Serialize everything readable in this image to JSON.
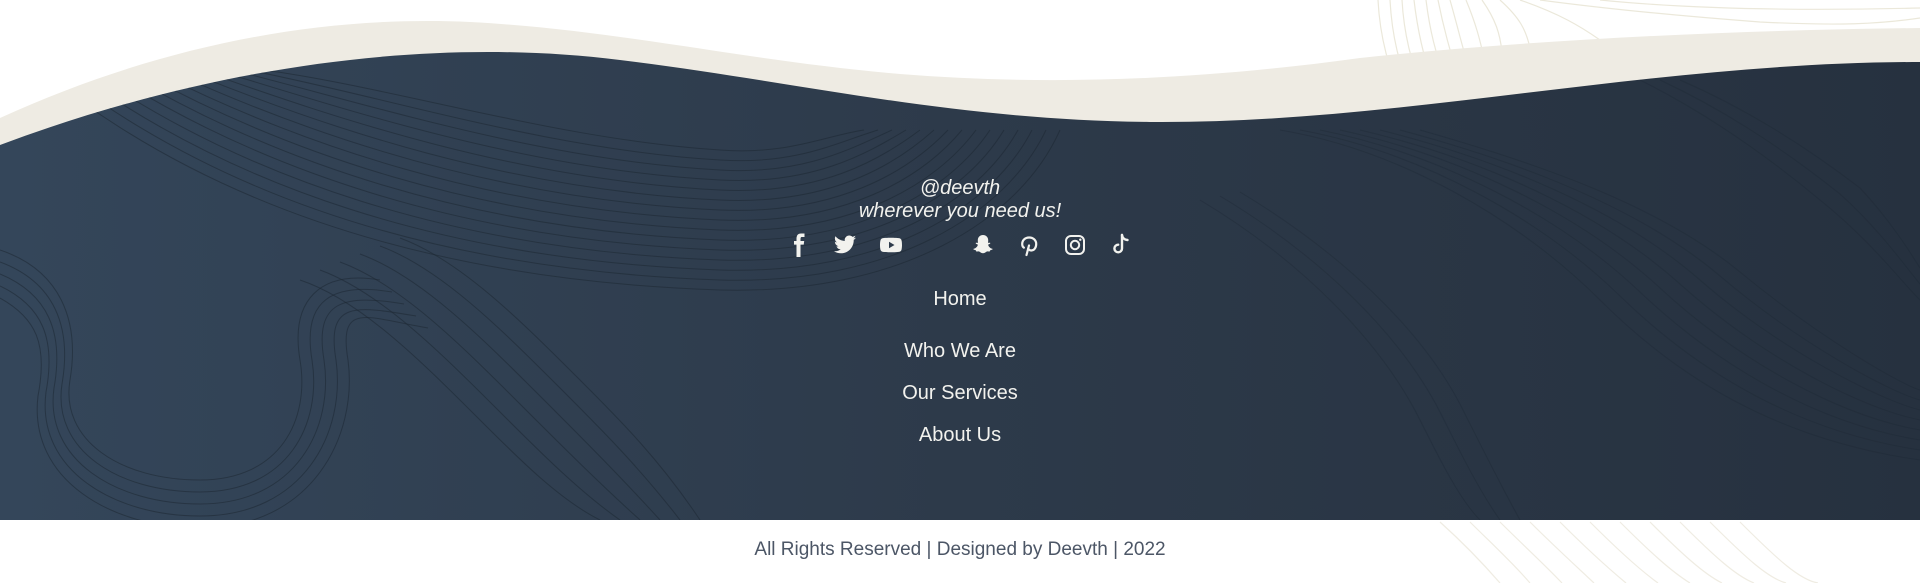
{
  "footer": {
    "handle": "@deevth",
    "tagline": "wherever you need us!",
    "social": [
      {
        "icon": "facebook-icon",
        "label": "Facebook"
      },
      {
        "icon": "twitter-icon",
        "label": "Twitter"
      },
      {
        "icon": "youtube-icon",
        "label": "YouTube"
      },
      {
        "icon": "empty-icon-slot",
        "label": ""
      },
      {
        "icon": "snapchat-icon",
        "label": "Snapchat"
      },
      {
        "icon": "pinterest-icon",
        "label": "Pinterest"
      },
      {
        "icon": "instagram-icon",
        "label": "Instagram"
      },
      {
        "icon": "tiktok-icon",
        "label": "TikTok"
      }
    ],
    "nav": {
      "home": "Home",
      "who_we_are": "Who We Are",
      "our_services": "Our Services",
      "about_us": "About Us"
    },
    "copyright": "All Rights Reserved | Designed by Deevth | 2022"
  },
  "colors": {
    "footer_bg": "#2f3c4b",
    "footer_bg_dark": "#253240",
    "wave_band": "#eeebe3",
    "text_light": "#f2f2ee",
    "copyright_text": "#4c5666",
    "line_pattern": "#1e2833",
    "cream_lines": "#ebe8da"
  }
}
